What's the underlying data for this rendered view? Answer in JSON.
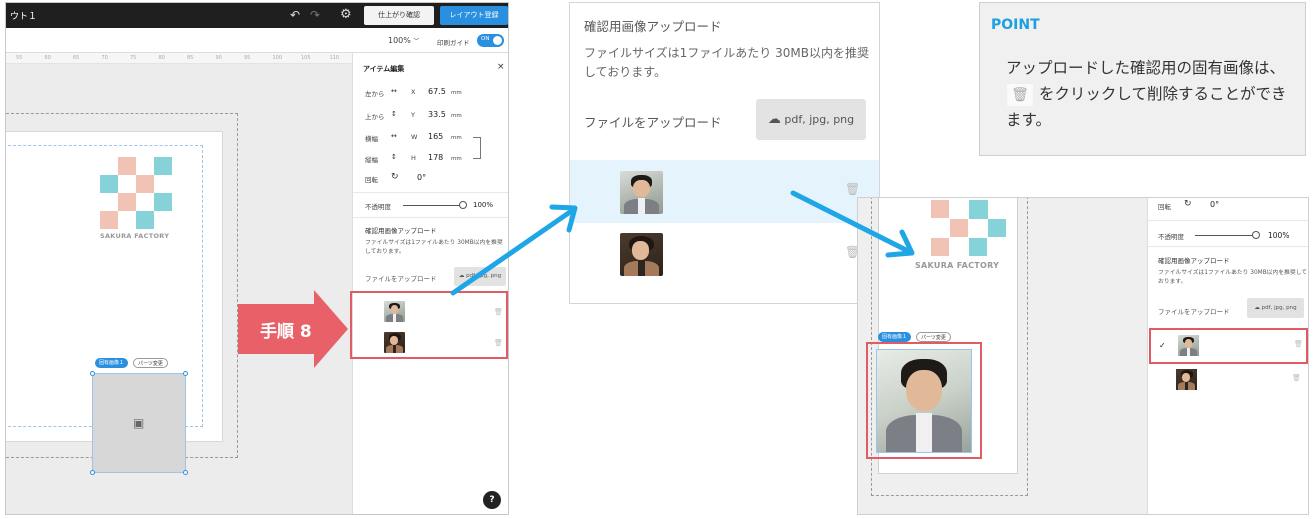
{
  "editor": {
    "title": "ウト１",
    "preview_button": "仕上がり確認",
    "register_button": "レイアウト登録",
    "zoom": "100%",
    "print_guide_label": "印刷ガイド",
    "print_guide_toggle": "ON",
    "ruler_numbers": [
      "55",
      "60",
      "65",
      "70",
      "75",
      "80",
      "85",
      "90",
      "95",
      "100",
      "105",
      "110"
    ],
    "logo_text": "SAKURA FACTORY",
    "tag_unique_image": "固有画像１",
    "tag_change_parts": "パーツ変更",
    "panel": {
      "title": "アイテム編集",
      "close": "×",
      "rows": [
        {
          "label": "左から",
          "axis": "X",
          "value": "67.5",
          "unit": "mm"
        },
        {
          "label": "上から",
          "axis": "Y",
          "value": "33.5",
          "unit": "mm"
        },
        {
          "label": "横幅",
          "axis": "W",
          "value": "165",
          "unit": "mm"
        },
        {
          "label": "縦幅",
          "axis": "H",
          "value": "178",
          "unit": "mm"
        }
      ],
      "rotate_label": "回転",
      "rotate_value": "0°",
      "opacity_label": "不透明度",
      "opacity_value": "100%",
      "opacity_fraction": 1.0,
      "upload_title": "確認用画像アップロード",
      "upload_desc": "ファイルサイズは1ファイルあたり 30MB以内を推奨しております。",
      "upload_label": "ファイルをアップロード",
      "upload_button": "pdf, jpg, png",
      "help": "?"
    }
  },
  "step_badge": "手順 8",
  "zoom_popup": {
    "title": "確認用画像アップロード",
    "desc": "ファイルサイズは1ファイルあたり 30MB以内を推奨しております。",
    "upload_label": "ファイルをアップロード",
    "upload_button": "pdf, jpg, png"
  },
  "point": {
    "title": "POINT",
    "text_before": "アップロードした確認用の固有画像は、",
    "text_after": " をクリックして削除することができます。"
  },
  "result": {
    "logo_text": "SAKURA FACTORY",
    "tag_unique_image": "固有画像１",
    "tag_change_parts": "パーツ変更",
    "rotate_label": "回転",
    "rotate_value": "0°",
    "opacity_label": "不透明度",
    "opacity_value": "100%",
    "upload_title": "確認用画像アップロード",
    "upload_desc": "ファイルサイズは1ファイルあたり 30MB以内を推奨しております。",
    "upload_label": "ファイルをアップロード",
    "upload_button": "pdf, jpg, png",
    "check": "✓"
  },
  "colors": {
    "accent_blue": "#2b8fe0",
    "highlight_red": "#e05b63",
    "arrow_blue": "#1ea6e6",
    "point_blue": "#1ba0e2"
  },
  "icons": [
    "undo-icon",
    "redo-icon",
    "gear-icon",
    "chevron-down-icon",
    "close-icon",
    "rotate-icon",
    "cloud-upload-icon",
    "trash-icon",
    "image-icon",
    "help-icon",
    "check-icon"
  ]
}
